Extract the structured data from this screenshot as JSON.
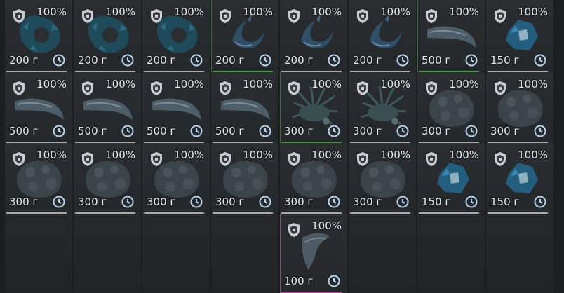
{
  "inventory": {
    "slots": [
      {
        "pct": "100%",
        "weight": "200 г",
        "item": "coral-ring",
        "border": "none"
      },
      {
        "pct": "100%",
        "weight": "200 г",
        "item": "coral-ring",
        "border": "none"
      },
      {
        "pct": "100%",
        "weight": "200 г",
        "item": "coral-ring",
        "border": "none"
      },
      {
        "pct": "100%",
        "weight": "200 г",
        "item": "claw",
        "border": "green"
      },
      {
        "pct": "100%",
        "weight": "200 г",
        "item": "claw",
        "border": "none"
      },
      {
        "pct": "100%",
        "weight": "200 г",
        "item": "claw",
        "border": "none"
      },
      {
        "pct": "100%",
        "weight": "500 г",
        "item": "tusk",
        "border": "green"
      },
      {
        "pct": "100%",
        "weight": "150 г",
        "item": "blue-gem",
        "border": "none"
      },
      {
        "pct": "100%",
        "weight": "500 г",
        "item": "tusk",
        "border": "none"
      },
      {
        "pct": "100%",
        "weight": "500 г",
        "item": "tusk",
        "border": "none"
      },
      {
        "pct": "100%",
        "weight": "500 г",
        "item": "tusk",
        "border": "none"
      },
      {
        "pct": "100%",
        "weight": "500 г",
        "item": "tusk",
        "border": "none"
      },
      {
        "pct": "100%",
        "weight": "300 г",
        "item": "spiky",
        "border": "green"
      },
      {
        "pct": "100%",
        "weight": "300 г",
        "item": "spiky",
        "border": "none"
      },
      {
        "pct": "100%",
        "weight": "300 г",
        "item": "rock",
        "border": "none"
      },
      {
        "pct": "100%",
        "weight": "300 г",
        "item": "rock",
        "border": "none"
      },
      {
        "pct": "100%",
        "weight": "300 г",
        "item": "rock",
        "border": "none"
      },
      {
        "pct": "100%",
        "weight": "300 г",
        "item": "rock",
        "border": "none"
      },
      {
        "pct": "100%",
        "weight": "300 г",
        "item": "rock",
        "border": "none"
      },
      {
        "pct": "100%",
        "weight": "300 г",
        "item": "rock",
        "border": "none"
      },
      {
        "pct": "100%",
        "weight": "300 г",
        "item": "rock",
        "border": "none"
      },
      {
        "pct": "100%",
        "weight": "300 г",
        "item": "rock",
        "border": "none"
      },
      {
        "pct": "100%",
        "weight": "150 г",
        "item": "blue-gem",
        "border": "none"
      },
      {
        "pct": "100%",
        "weight": "150 г",
        "item": "blue-gem",
        "border": "none"
      },
      {
        "empty": true
      },
      {
        "empty": true
      },
      {
        "empty": true
      },
      {
        "empty": true
      },
      {
        "pct": "100%",
        "weight": "100 г",
        "item": "horn",
        "border": "pink"
      },
      {
        "empty": true
      },
      {
        "empty": true
      },
      {
        "empty": true
      }
    ]
  }
}
